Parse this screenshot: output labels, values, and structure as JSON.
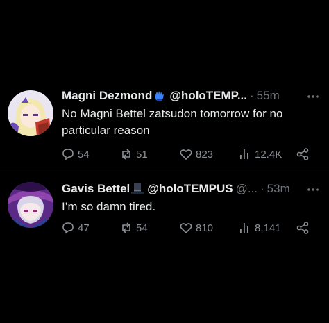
{
  "tweets": [
    {
      "author_name": "Magni Dezmond",
      "badge_icon": "blue-glove-emoji",
      "handle": "@holoTEMP...",
      "separator": "·",
      "time": "55m",
      "text": "No Magni Bettel zatsudon tomorrow for no particular reason",
      "replies": "54",
      "retweets": "51",
      "likes": "823",
      "views": "12.4K"
    },
    {
      "author_name": "Gavis Bettel",
      "badge_icon": "top-hat-emoji",
      "handle": "@holoTEMPUS",
      "handle_suffix": "@...",
      "separator": "·",
      "time": "53m",
      "text": "I’m so damn tired.",
      "replies": "47",
      "retweets": "54",
      "likes": "810",
      "views": "8,141"
    }
  ],
  "colors": {
    "background": "#000000",
    "primary_text": "#e7e9ea",
    "secondary_text": "#71767b",
    "divider": "#2f3336"
  }
}
